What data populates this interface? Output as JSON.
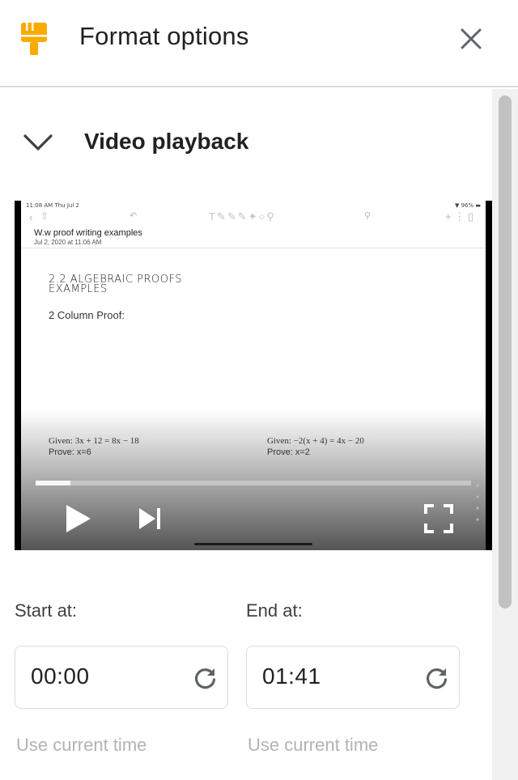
{
  "header": {
    "title": "Format options",
    "icon": "paint-brush-icon",
    "close_icon": "close-icon",
    "accent_color": "#f9ab00"
  },
  "section": {
    "title": "Video playback",
    "expanded": true,
    "icon": "chevron-down-icon"
  },
  "video": {
    "status_left": "11:08 AM  Thu Jul 2",
    "status_right": "▼ 96% ▬",
    "note_title": "W.w proof writing examples",
    "note_date": "Jul 2, 2020 at 11:06 AM",
    "heading_line1": "2.2 ALGEBRAIC PROOFS",
    "heading_line2": "EXAMPLES",
    "subheading": "2 Column Proof:",
    "given_left": "Given: 3x + 12 = 8x − 18",
    "prove_left": "Prove: x=6",
    "given_right": "Given: −2(x + 4) = 4x − 20",
    "prove_right": "Prove: x=2",
    "progress": 0.08
  },
  "start": {
    "label": "Start at:",
    "value": "00:00",
    "use_current": "Use current time"
  },
  "end": {
    "label": "End at:",
    "value": "01:41",
    "use_current": "Use current time"
  }
}
